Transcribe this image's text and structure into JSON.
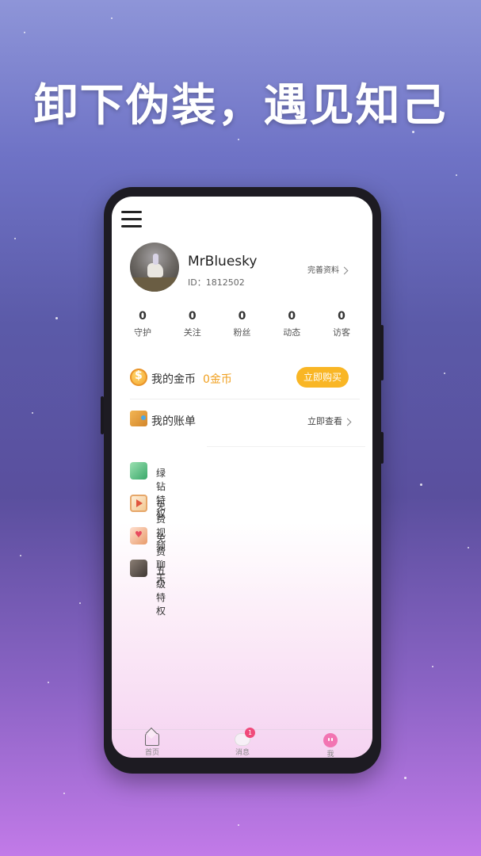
{
  "headline": "卸下伪装，遇见知己",
  "profile": {
    "username": "MrBluesky",
    "id_text": "ID：1812502",
    "edit_label": "完善资料"
  },
  "stats": [
    {
      "num": "0",
      "label": "守护"
    },
    {
      "num": "0",
      "label": "关注"
    },
    {
      "num": "0",
      "label": "粉丝"
    },
    {
      "num": "0",
      "label": "动态"
    },
    {
      "num": "0",
      "label": "访客"
    }
  ],
  "coins": {
    "label": "我的金币",
    "value": "0金币",
    "buy_label": "立即购买",
    "icon": "coin-icon"
  },
  "bill": {
    "label": "我的账单",
    "link_label": "立即查看",
    "icon": "wallet-icon"
  },
  "privileges": [
    {
      "label": "绿钻特权",
      "icon": "green-diamond-icon"
    },
    {
      "label": "免费视频",
      "icon": "video-icon"
    },
    {
      "label": "免费聊天",
      "icon": "chat-icon"
    },
    {
      "label": "五级特权",
      "icon": "level-icon"
    }
  ],
  "tabbar": {
    "home": "首页",
    "messages": "消息",
    "messages_badge": "1",
    "me": "我"
  },
  "colors": {
    "accent_gold": "#f9b625",
    "coin_text": "#f0a020",
    "badge": "#f04a7a",
    "me_tab": "#f274b2"
  }
}
